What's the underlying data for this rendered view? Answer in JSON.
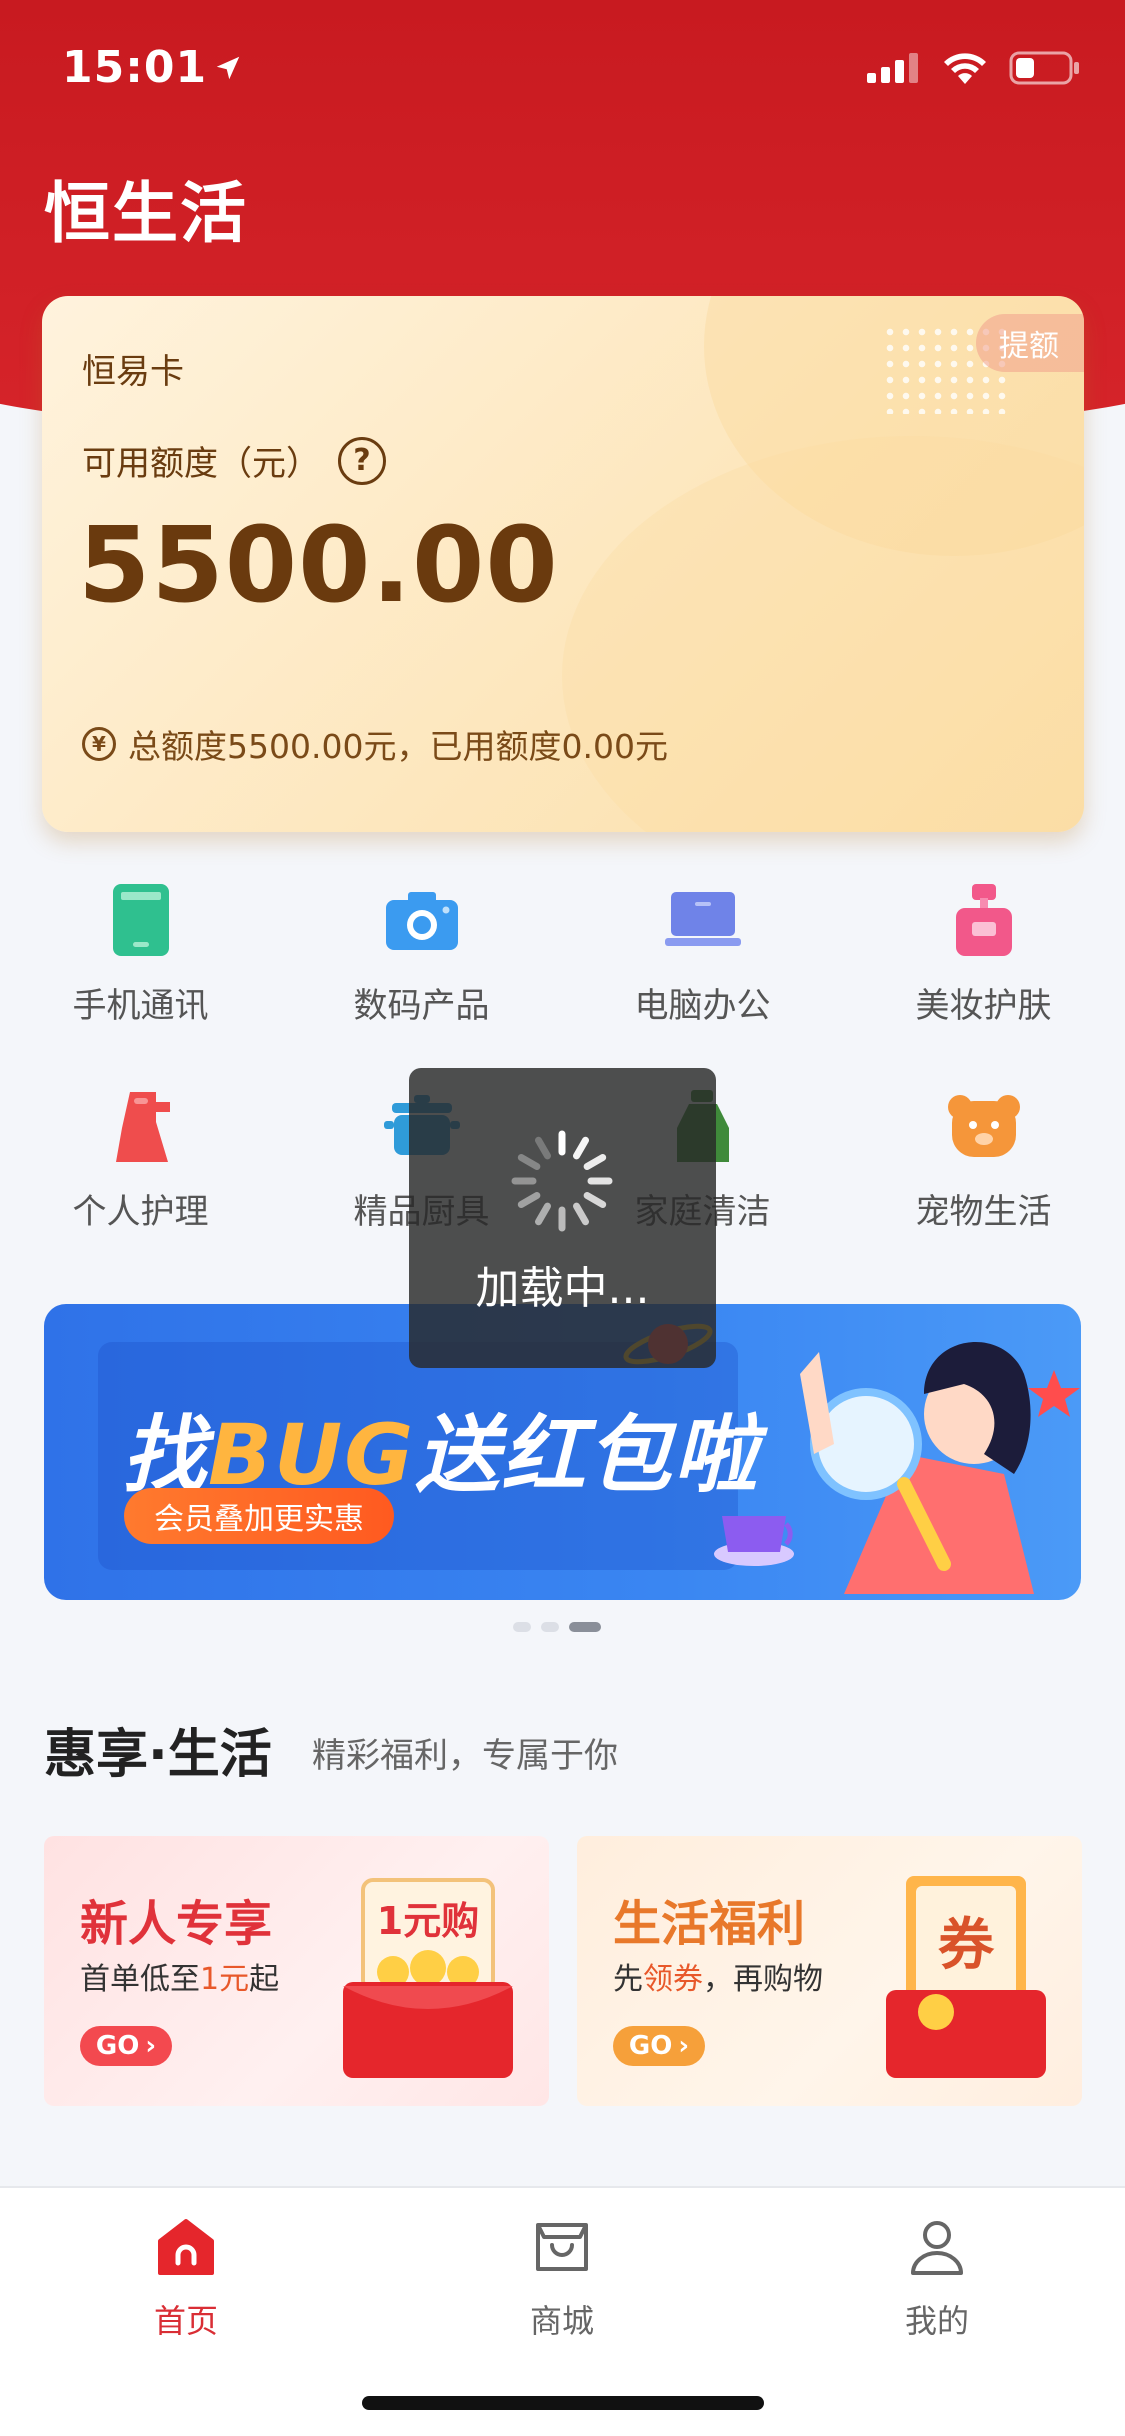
{
  "status_bar": {
    "time": "15:01"
  },
  "app": {
    "logo_text": "恒生活"
  },
  "card": {
    "name": "恒易卡",
    "raise_label": "提额",
    "available_label": "可用额度（元）",
    "help_symbol": "?",
    "amount": "5500.00",
    "summary": "总额度5500.00元，已用额度0.00元"
  },
  "categories": [
    {
      "label": "手机通讯",
      "icon": "phone-icon",
      "color": "#2fc08f"
    },
    {
      "label": "数码产品",
      "icon": "camera-icon",
      "color": "#3b9bf0"
    },
    {
      "label": "电脑办公",
      "icon": "laptop-icon",
      "color": "#6f83e8"
    },
    {
      "label": "美妆护肤",
      "icon": "perfume-icon",
      "color": "#f2588a"
    },
    {
      "label": "个人护理",
      "icon": "hair-dryer-icon",
      "color": "#ef4d4d"
    },
    {
      "label": "精品厨具",
      "icon": "pot-icon",
      "color": "#2f9bd9"
    },
    {
      "label": "家庭清洁",
      "icon": "cleaning-icon",
      "color": "#3f8a3a"
    },
    {
      "label": "宠物生活",
      "icon": "pet-icon",
      "color": "#f5963a"
    }
  ],
  "banner": {
    "title_prefix": "找",
    "title_highlight": "BUG",
    "title_suffix": "送红包啦",
    "pill": "会员叠加更实惠"
  },
  "section": {
    "title": "惠享·生活",
    "subtitle": "精彩福利，专属于你"
  },
  "promos": [
    {
      "title": "新人专享",
      "desc_pre": "首单低至",
      "desc_hl": "1元",
      "desc_post": "起",
      "go": "GO",
      "art_text": "1元购"
    },
    {
      "title": "生活福利",
      "desc_pre": "先",
      "desc_hl": "领券",
      "desc_post": "，再购物",
      "go": "GO",
      "art_text": "券"
    }
  ],
  "nav": [
    {
      "label": "首页",
      "icon": "home-icon",
      "active": true
    },
    {
      "label": "商城",
      "icon": "shopping-bag-icon",
      "active": false
    },
    {
      "label": "我的",
      "icon": "user-icon",
      "active": false
    }
  ],
  "loading": {
    "text": "加载中..."
  },
  "colors": {
    "brand_red": "#d6242a",
    "amount_brown": "#6a3a0e",
    "toast_bg": "#282828"
  }
}
